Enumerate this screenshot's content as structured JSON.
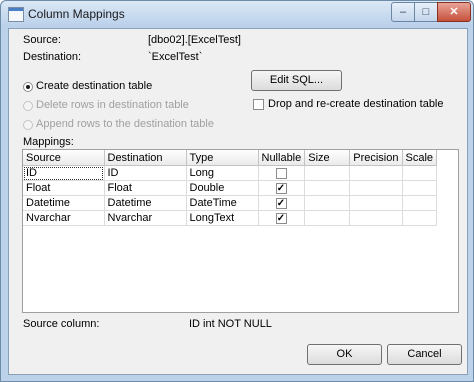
{
  "window": {
    "title": "Column Mappings",
    "icon": "app-icon",
    "controls": {
      "minimize": "–",
      "maximize": "□",
      "close": "✕"
    }
  },
  "info": {
    "source_label": "Source:",
    "source_value": "[dbo02].[ExcelTest]",
    "destination_label": "Destination:",
    "destination_value": "`ExcelTest`"
  },
  "options": {
    "create_label": "Create destination table",
    "delete_label": "Delete rows in destination table",
    "append_label": "Append rows to the destination table",
    "edit_sql_label": "Edit SQL...",
    "drop_recreate_label": "Drop and re-create destination table"
  },
  "mappings": {
    "label": "Mappings:",
    "columns": [
      "Source",
      "Destination",
      "Type",
      "Nullable",
      "Size",
      "Precision",
      "Scale"
    ],
    "rows": [
      {
        "source": "ID",
        "destination": "ID",
        "type": "Long",
        "nullable": false,
        "size": "",
        "precision": "",
        "scale": ""
      },
      {
        "source": "Float",
        "destination": "Float",
        "type": "Double",
        "nullable": true,
        "size": "",
        "precision": "",
        "scale": ""
      },
      {
        "source": "Datetime",
        "destination": "Datetime",
        "type": "DateTime",
        "nullable": true,
        "size": "",
        "precision": "",
        "scale": ""
      },
      {
        "source": "Nvarchar",
        "destination": "Nvarchar",
        "type": "LongText",
        "nullable": true,
        "size": "",
        "precision": "",
        "scale": ""
      }
    ]
  },
  "footer": {
    "source_column_label": "Source column:",
    "source_column_value": "ID int NOT NULL",
    "ok_label": "OK",
    "cancel_label": "Cancel"
  }
}
